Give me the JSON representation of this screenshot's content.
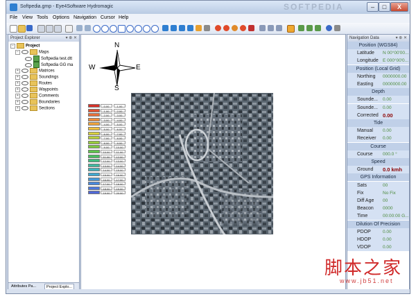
{
  "window": {
    "title": "Softpedia.gmp - Eye4Software Hydromagic",
    "watermark": "SOFTPEDIA",
    "min_label": "–",
    "max_label": "□",
    "close_label": "X"
  },
  "menu": [
    "File",
    "View",
    "Tools",
    "Options",
    "Navigation",
    "Cursor",
    "Help"
  ],
  "explorer": {
    "title": "Project Explorer",
    "controls": "▾ ⊕ ✕",
    "tree": {
      "project": "Project",
      "maps": "Maps",
      "map_files": [
        "Softpedia test.dtt",
        "Softpedia GG ma"
      ],
      "items": [
        "Matrices",
        "Soundings",
        "Routes",
        "Waypoints",
        "Comments",
        "Boundaries",
        "Sections"
      ]
    },
    "tabs": [
      "Attributes Pa...",
      "Project Explo..."
    ]
  },
  "compass": {
    "n": "N",
    "e": "E",
    "s": "S",
    "w": "W"
  },
  "legend": {
    "rows": [
      {
        "from": "0.00",
        "to": "1.00",
        "color": "#d8322a"
      },
      {
        "from": "1.00",
        "to": "2.00",
        "color": "#e05230"
      },
      {
        "from": "2.00",
        "to": "3.00",
        "color": "#e8703a"
      },
      {
        "from": "3.00",
        "to": "4.00",
        "color": "#ee8c3c"
      },
      {
        "from": "4.00",
        "to": "5.00",
        "color": "#f0a43c"
      },
      {
        "from": "5.00",
        "to": "6.00",
        "color": "#f0c040"
      },
      {
        "from": "6.00",
        "to": "7.00",
        "color": "#d8d040"
      },
      {
        "from": "7.00",
        "to": "8.00",
        "color": "#b8d03c"
      },
      {
        "from": "8.00",
        "to": "9.00",
        "color": "#98cc3c"
      },
      {
        "from": "9.00",
        "to": "10.00",
        "color": "#7cc840"
      },
      {
        "from": "10.00",
        "to": "11.00",
        "color": "#60c44c"
      },
      {
        "from": "11.00",
        "to": "12.00",
        "color": "#48c060"
      },
      {
        "from": "12.00",
        "to": "13.00",
        "color": "#40bc80"
      },
      {
        "from": "13.00",
        "to": "14.00",
        "color": "#40b8a0"
      },
      {
        "from": "14.00",
        "to": "15.00",
        "color": "#40b4bc"
      },
      {
        "from": "15.00",
        "to": "16.00",
        "color": "#40a8d0"
      },
      {
        "from": "16.00",
        "to": "17.00",
        "color": "#4498d8"
      },
      {
        "from": "17.00",
        "to": "18.00",
        "color": "#4888dc"
      },
      {
        "from": "18.00",
        "to": "19.00",
        "color": "#4c78dc"
      },
      {
        "from": "19.00",
        "to": "20.00",
        "color": "#5068d8"
      }
    ]
  },
  "nav": {
    "title": "Navigation Data",
    "controls": "▾ ⊕ ✕",
    "sections": [
      {
        "heading": "Position (WGS84)",
        "rows": [
          {
            "label": "Latitude",
            "value": "N 00°00'00..."
          },
          {
            "label": "Longitude",
            "value": "E 000°00'0..."
          }
        ]
      },
      {
        "heading": "Position (Local Grid)",
        "rows": [
          {
            "label": "Northing",
            "value": "0000000.00"
          },
          {
            "label": "Easting",
            "value": "0000000.00"
          }
        ]
      },
      {
        "heading": "Depth",
        "rows": [
          {
            "label": "Sounde...",
            "value": "0.00"
          },
          {
            "label": "Sounde...",
            "value": "0.00"
          },
          {
            "label": "Corrected",
            "value": "0.00",
            "bold": true
          }
        ]
      },
      {
        "heading": "Tide",
        "rows": [
          {
            "label": "Manual",
            "value": "0.00"
          },
          {
            "label": "Receiver",
            "value": "0.00"
          }
        ]
      },
      {
        "heading": "Course",
        "rows": [
          {
            "label": "Course",
            "value": "000.0 °"
          }
        ]
      },
      {
        "heading": "Speed",
        "rows": [
          {
            "label": "Ground",
            "value": "0.0 kmh",
            "bold": true
          }
        ]
      },
      {
        "heading": "GPS Information",
        "rows": [
          {
            "label": "Sats",
            "value": "00"
          },
          {
            "label": "Fix",
            "value": "No Fix"
          },
          {
            "label": "Diff Age",
            "value": "00"
          },
          {
            "label": "Beacon",
            "value": "0000"
          },
          {
            "label": "Time",
            "value": "00:00:00 G..."
          }
        ]
      },
      {
        "heading": "Dilution Of Precision",
        "rows": [
          {
            "label": "PDOP",
            "value": "0.00"
          },
          {
            "label": "HDOP",
            "value": "0.00"
          },
          {
            "label": "VDOP",
            "value": "0.00"
          }
        ]
      }
    ]
  },
  "watermark_cn": {
    "text": "脚本之家",
    "url": "www.jb51.net"
  },
  "colors": {
    "accent": "#2f7fd1",
    "nav_value": "#4c8a3c",
    "nav_bold": "#8b0000",
    "header": "#c0d0e8"
  }
}
